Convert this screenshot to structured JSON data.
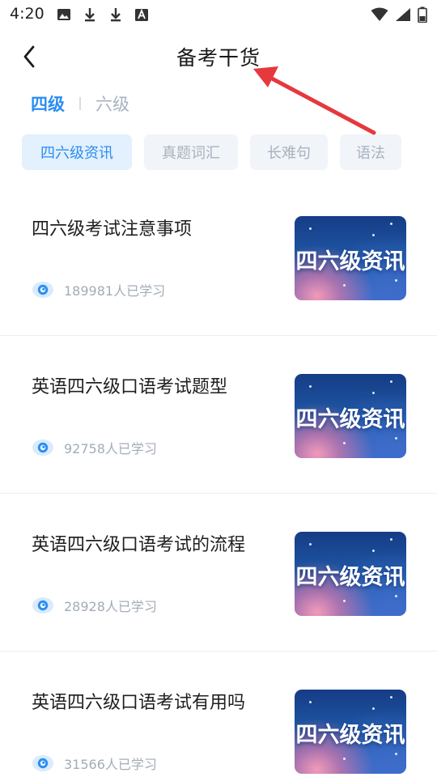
{
  "status_bar": {
    "time": "4:20",
    "left_icons": [
      "image-icon",
      "download-icon",
      "download-icon",
      "font-icon"
    ],
    "right_icons": [
      "wifi-icon",
      "signal-icon",
      "battery-icon"
    ]
  },
  "header": {
    "title": "备考干货",
    "back_icon": "chevron-left-icon"
  },
  "level_tabs": [
    {
      "label": "四级",
      "active": true
    },
    {
      "label": "六级",
      "active": false
    }
  ],
  "categories": [
    {
      "label": "四六级资讯",
      "active": true
    },
    {
      "label": "真题词汇",
      "active": false
    },
    {
      "label": "长难句",
      "active": false
    },
    {
      "label": "语法",
      "active": false
    }
  ],
  "articles": [
    {
      "title": "四六级考试注意事项",
      "count": "189981人已学习",
      "thumb_text": "四六级资讯"
    },
    {
      "title": "英语四六级口语考试题型",
      "count": "92758人已学习",
      "thumb_text": "四六级资讯"
    },
    {
      "title": "英语四六级口语考试的流程",
      "count": "28928人已学习",
      "thumb_text": "四六级资讯"
    },
    {
      "title": "英语四六级口语考试有用吗",
      "count": "31566人已学习",
      "thumb_text": "四六级资讯"
    }
  ],
  "colors": {
    "accent": "#2b8ef0",
    "inactive_text": "#a8b2bf",
    "chip_active_bg": "#e3f0fd",
    "chip_bg": "#f1f4f8",
    "annotation_arrow": "#e5393d"
  }
}
